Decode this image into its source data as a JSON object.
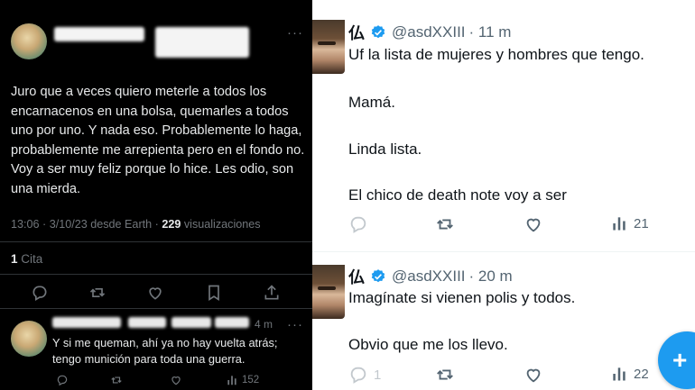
{
  "left": {
    "tweet_text": "Juro que a veces quiero meterle a todos los encarnacenos en una bolsa, quemarles a todos uno por uno. Y nada eso. Probablemente lo haga, probablemente me arrepienta pero en el fondo no. Voy a ser muy feliz porque lo hice. Les odio, son una mierda.",
    "meta_time": "13:06 · 3/10/23 desde Earth · ",
    "views_count": "229",
    "views_label": " visualizaciones",
    "quotes_count": "1",
    "quotes_label": " Cita",
    "more_label": "···",
    "reply": {
      "time_suffix": "4 m",
      "text": "Y si me queman, ahí ya no hay vuelta atrás; tengo munición para toda una guerra.",
      "views": "152"
    },
    "icons": [
      "reply-icon",
      "retweet-icon",
      "like-icon",
      "bookmark-icon",
      "share-icon",
      "views-icon"
    ]
  },
  "right": {
    "tweet1": {
      "name_glyph": "仏",
      "handle": "@asdXXIII",
      "time": "· 11 m",
      "lines": [
        "Uf la lista de mujeres y hombres que tengo.",
        "Mamá.",
        "Linda lista.",
        "El chico de death note voy a ser"
      ],
      "views": "21"
    },
    "tweet2": {
      "name_glyph": "仏",
      "handle": "@asdXXIII",
      "time": "· 20 m",
      "lines": [
        "Imagínate si vienen polis y todos.",
        "Obvio que me los llevo."
      ],
      "replies": "1",
      "views": "22"
    },
    "fab_label": "+",
    "colors": {
      "accent": "#1d9bf0",
      "verified": "#1d9bf0",
      "muted": "#536471"
    }
  }
}
